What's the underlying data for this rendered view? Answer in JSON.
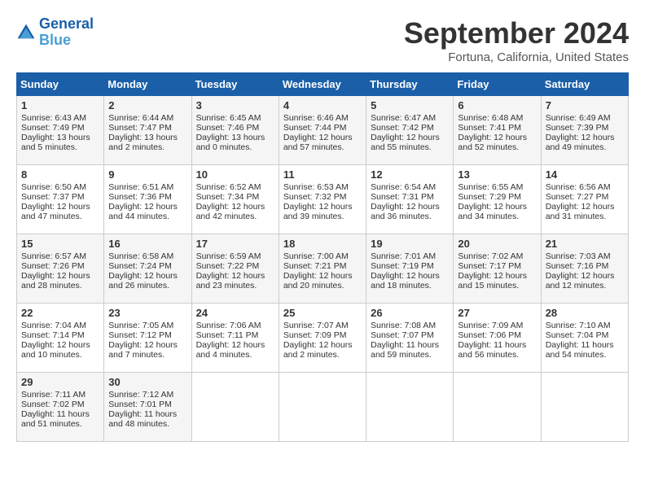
{
  "header": {
    "logo_line1": "General",
    "logo_line2": "Blue",
    "month": "September 2024",
    "location": "Fortuna, California, United States"
  },
  "weekdays": [
    "Sunday",
    "Monday",
    "Tuesday",
    "Wednesday",
    "Thursday",
    "Friday",
    "Saturday"
  ],
  "weeks": [
    [
      {
        "day": "1",
        "lines": [
          "Sunrise: 6:43 AM",
          "Sunset: 7:49 PM",
          "Daylight: 13 hours",
          "and 5 minutes."
        ]
      },
      {
        "day": "2",
        "lines": [
          "Sunrise: 6:44 AM",
          "Sunset: 7:47 PM",
          "Daylight: 13 hours",
          "and 2 minutes."
        ]
      },
      {
        "day": "3",
        "lines": [
          "Sunrise: 6:45 AM",
          "Sunset: 7:46 PM",
          "Daylight: 13 hours",
          "and 0 minutes."
        ]
      },
      {
        "day": "4",
        "lines": [
          "Sunrise: 6:46 AM",
          "Sunset: 7:44 PM",
          "Daylight: 12 hours",
          "and 57 minutes."
        ]
      },
      {
        "day": "5",
        "lines": [
          "Sunrise: 6:47 AM",
          "Sunset: 7:42 PM",
          "Daylight: 12 hours",
          "and 55 minutes."
        ]
      },
      {
        "day": "6",
        "lines": [
          "Sunrise: 6:48 AM",
          "Sunset: 7:41 PM",
          "Daylight: 12 hours",
          "and 52 minutes."
        ]
      },
      {
        "day": "7",
        "lines": [
          "Sunrise: 6:49 AM",
          "Sunset: 7:39 PM",
          "Daylight: 12 hours",
          "and 49 minutes."
        ]
      }
    ],
    [
      {
        "day": "8",
        "lines": [
          "Sunrise: 6:50 AM",
          "Sunset: 7:37 PM",
          "Daylight: 12 hours",
          "and 47 minutes."
        ]
      },
      {
        "day": "9",
        "lines": [
          "Sunrise: 6:51 AM",
          "Sunset: 7:36 PM",
          "Daylight: 12 hours",
          "and 44 minutes."
        ]
      },
      {
        "day": "10",
        "lines": [
          "Sunrise: 6:52 AM",
          "Sunset: 7:34 PM",
          "Daylight: 12 hours",
          "and 42 minutes."
        ]
      },
      {
        "day": "11",
        "lines": [
          "Sunrise: 6:53 AM",
          "Sunset: 7:32 PM",
          "Daylight: 12 hours",
          "and 39 minutes."
        ]
      },
      {
        "day": "12",
        "lines": [
          "Sunrise: 6:54 AM",
          "Sunset: 7:31 PM",
          "Daylight: 12 hours",
          "and 36 minutes."
        ]
      },
      {
        "day": "13",
        "lines": [
          "Sunrise: 6:55 AM",
          "Sunset: 7:29 PM",
          "Daylight: 12 hours",
          "and 34 minutes."
        ]
      },
      {
        "day": "14",
        "lines": [
          "Sunrise: 6:56 AM",
          "Sunset: 7:27 PM",
          "Daylight: 12 hours",
          "and 31 minutes."
        ]
      }
    ],
    [
      {
        "day": "15",
        "lines": [
          "Sunrise: 6:57 AM",
          "Sunset: 7:26 PM",
          "Daylight: 12 hours",
          "and 28 minutes."
        ]
      },
      {
        "day": "16",
        "lines": [
          "Sunrise: 6:58 AM",
          "Sunset: 7:24 PM",
          "Daylight: 12 hours",
          "and 26 minutes."
        ]
      },
      {
        "day": "17",
        "lines": [
          "Sunrise: 6:59 AM",
          "Sunset: 7:22 PM",
          "Daylight: 12 hours",
          "and 23 minutes."
        ]
      },
      {
        "day": "18",
        "lines": [
          "Sunrise: 7:00 AM",
          "Sunset: 7:21 PM",
          "Daylight: 12 hours",
          "and 20 minutes."
        ]
      },
      {
        "day": "19",
        "lines": [
          "Sunrise: 7:01 AM",
          "Sunset: 7:19 PM",
          "Daylight: 12 hours",
          "and 18 minutes."
        ]
      },
      {
        "day": "20",
        "lines": [
          "Sunrise: 7:02 AM",
          "Sunset: 7:17 PM",
          "Daylight: 12 hours",
          "and 15 minutes."
        ]
      },
      {
        "day": "21",
        "lines": [
          "Sunrise: 7:03 AM",
          "Sunset: 7:16 PM",
          "Daylight: 12 hours",
          "and 12 minutes."
        ]
      }
    ],
    [
      {
        "day": "22",
        "lines": [
          "Sunrise: 7:04 AM",
          "Sunset: 7:14 PM",
          "Daylight: 12 hours",
          "and 10 minutes."
        ]
      },
      {
        "day": "23",
        "lines": [
          "Sunrise: 7:05 AM",
          "Sunset: 7:12 PM",
          "Daylight: 12 hours",
          "and 7 minutes."
        ]
      },
      {
        "day": "24",
        "lines": [
          "Sunrise: 7:06 AM",
          "Sunset: 7:11 PM",
          "Daylight: 12 hours",
          "and 4 minutes."
        ]
      },
      {
        "day": "25",
        "lines": [
          "Sunrise: 7:07 AM",
          "Sunset: 7:09 PM",
          "Daylight: 12 hours",
          "and 2 minutes."
        ]
      },
      {
        "day": "26",
        "lines": [
          "Sunrise: 7:08 AM",
          "Sunset: 7:07 PM",
          "Daylight: 11 hours",
          "and 59 minutes."
        ]
      },
      {
        "day": "27",
        "lines": [
          "Sunrise: 7:09 AM",
          "Sunset: 7:06 PM",
          "Daylight: 11 hours",
          "and 56 minutes."
        ]
      },
      {
        "day": "28",
        "lines": [
          "Sunrise: 7:10 AM",
          "Sunset: 7:04 PM",
          "Daylight: 11 hours",
          "and 54 minutes."
        ]
      }
    ],
    [
      {
        "day": "29",
        "lines": [
          "Sunrise: 7:11 AM",
          "Sunset: 7:02 PM",
          "Daylight: 11 hours",
          "and 51 minutes."
        ]
      },
      {
        "day": "30",
        "lines": [
          "Sunrise: 7:12 AM",
          "Sunset: 7:01 PM",
          "Daylight: 11 hours",
          "and 48 minutes."
        ]
      },
      {
        "day": "",
        "lines": []
      },
      {
        "day": "",
        "lines": []
      },
      {
        "day": "",
        "lines": []
      },
      {
        "day": "",
        "lines": []
      },
      {
        "day": "",
        "lines": []
      }
    ]
  ]
}
